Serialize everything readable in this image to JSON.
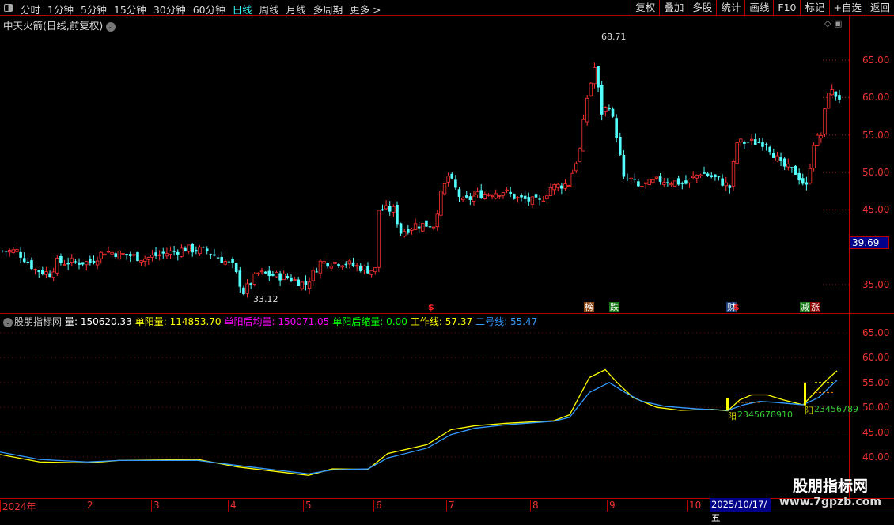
{
  "toolbar": {
    "periods": [
      "分时",
      "1分钟",
      "5分钟",
      "15分钟",
      "30分钟",
      "60分钟",
      "日线",
      "周线",
      "月线",
      "多周期",
      "更多 >"
    ],
    "active": "日线",
    "buttons": [
      "复权",
      "叠加",
      "多股",
      "统计",
      "画线",
      "F10",
      "标记",
      "+自选",
      "返回"
    ]
  },
  "stock": {
    "title": "中天火箭(日线,前复权)",
    "last_price": "39.69",
    "high_label": "68.71",
    "low_label": "33.12"
  },
  "price_axis": [
    "65.00",
    "60.00",
    "55.00",
    "50.00",
    "45.00",
    "35.00"
  ],
  "events": {
    "dollar1": "$",
    "bang": "榜",
    "die": "跌",
    "cai": "财",
    "dollar2": "$",
    "jian": "减",
    "zhang": "涨"
  },
  "indicator": {
    "name": "股朋指标网",
    "items": [
      {
        "label": "量:",
        "value": "150620.33",
        "color": "#ffffff"
      },
      {
        "label": "单阳量:",
        "value": "114853.70",
        "color": "#ffff00"
      },
      {
        "label": "单阳后均量:",
        "value": "150071.05",
        "color": "#ff00ff"
      },
      {
        "label": "单阳后缩量:",
        "value": "0.00",
        "color": "#00ff00"
      },
      {
        "label": "工作线:",
        "value": "57.37",
        "color": "#ffff00"
      },
      {
        "label": "二号线:",
        "value": "55.47",
        "color": "#3399ff"
      }
    ],
    "axis": [
      "65.00",
      "60.00",
      "55.00",
      "50.00",
      "45.00",
      "40.00"
    ],
    "mark1": "阳",
    "mark1_seq": "2345678910",
    "mark2": "阳",
    "mark2_seq": "23456789"
  },
  "date_axis": {
    "labels": [
      "2024年",
      "2",
      "3",
      "4",
      "5",
      "6",
      "7",
      "8",
      "9",
      "10"
    ],
    "current": "2025/10/17/五"
  },
  "watermark": {
    "title": "股朋指标网",
    "url": "www.7gpzb.com"
  },
  "chart_data": {
    "type": "candlestick",
    "price_path": [
      [
        0,
        39.5
      ],
      [
        4,
        39.5
      ],
      [
        9,
        37
      ],
      [
        13,
        36.5
      ],
      [
        15,
        38
      ],
      [
        24,
        38
      ],
      [
        28,
        39.5
      ],
      [
        39,
        38.5
      ],
      [
        43,
        39
      ],
      [
        50,
        39.8
      ],
      [
        56,
        39.5
      ],
      [
        63,
        37.5
      ],
      [
        66,
        34
      ],
      [
        70,
        36.5
      ],
      [
        78,
        36
      ],
      [
        83,
        35
      ],
      [
        87,
        38
      ],
      [
        93,
        38
      ],
      [
        100,
        37
      ],
      [
        102,
        37
      ],
      [
        103,
        45
      ],
      [
        107,
        45
      ],
      [
        109,
        42
      ],
      [
        113,
        43
      ],
      [
        118,
        43
      ],
      [
        120,
        47
      ],
      [
        122,
        49.5
      ],
      [
        126,
        46
      ],
      [
        130,
        47
      ],
      [
        137,
        47.5
      ],
      [
        141,
        46.5
      ],
      [
        147,
        46
      ],
      [
        150,
        48
      ],
      [
        155,
        48.5
      ],
      [
        158,
        53
      ],
      [
        160,
        60
      ],
      [
        162,
        64
      ],
      [
        164,
        58
      ],
      [
        166,
        59
      ],
      [
        168,
        55
      ],
      [
        170,
        49
      ],
      [
        172,
        49
      ],
      [
        174,
        48
      ],
      [
        180,
        49
      ],
      [
        187,
        48.5
      ],
      [
        191,
        50
      ],
      [
        196,
        49
      ],
      [
        199,
        48
      ],
      [
        201,
        54
      ],
      [
        204,
        54
      ],
      [
        209,
        54
      ],
      [
        213,
        51
      ],
      [
        217,
        50
      ],
      [
        220,
        48
      ],
      [
        222,
        54
      ],
      [
        224,
        55
      ],
      [
        226,
        61
      ],
      [
        229,
        60
      ]
    ],
    "work_line": [
      [
        0,
        40.5
      ],
      [
        50,
        39
      ],
      [
        110,
        38.8
      ],
      [
        150,
        39.3
      ],
      [
        250,
        39.5
      ],
      [
        300,
        38
      ],
      [
        390,
        36.3
      ],
      [
        420,
        37.6
      ],
      [
        465,
        37.5
      ],
      [
        490,
        40.7
      ],
      [
        540,
        42.5
      ],
      [
        570,
        45.5
      ],
      [
        600,
        46.3
      ],
      [
        640,
        46.8
      ],
      [
        700,
        47.3
      ],
      [
        720,
        48.5
      ],
      [
        745,
        56
      ],
      [
        765,
        57.6
      ],
      [
        780,
        55
      ],
      [
        800,
        52
      ],
      [
        830,
        50
      ],
      [
        860,
        49.4
      ],
      [
        900,
        49.6
      ],
      [
        920,
        49.3
      ],
      [
        935,
        51.5
      ],
      [
        950,
        52.5
      ],
      [
        970,
        52.5
      ],
      [
        990,
        51.5
      ],
      [
        1015,
        50.5
      ],
      [
        1030,
        53
      ],
      [
        1045,
        55.5
      ],
      [
        1058,
        57.37
      ]
    ],
    "line2": [
      [
        0,
        41
      ],
      [
        50,
        39.5
      ],
      [
        110,
        39
      ],
      [
        150,
        39.3
      ],
      [
        250,
        39.3
      ],
      [
        300,
        38.3
      ],
      [
        390,
        36.6
      ],
      [
        420,
        37.4
      ],
      [
        465,
        37.6
      ],
      [
        490,
        39.8
      ],
      [
        540,
        41.8
      ],
      [
        570,
        44.5
      ],
      [
        600,
        45.8
      ],
      [
        640,
        46.5
      ],
      [
        700,
        47.2
      ],
      [
        720,
        48
      ],
      [
        745,
        53
      ],
      [
        770,
        55
      ],
      [
        790,
        53
      ],
      [
        810,
        51.3
      ],
      [
        840,
        50.2
      ],
      [
        880,
        49.7
      ],
      [
        920,
        49.4
      ],
      [
        940,
        50.5
      ],
      [
        960,
        51.2
      ],
      [
        980,
        51
      ],
      [
        1015,
        50.5
      ],
      [
        1035,
        52
      ],
      [
        1058,
        55.47
      ]
    ]
  }
}
